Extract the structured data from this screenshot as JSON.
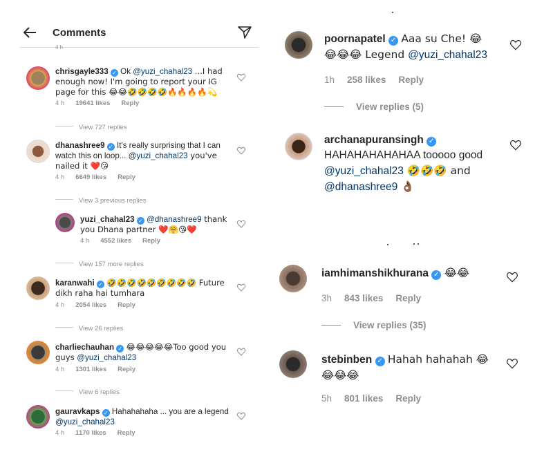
{
  "header": {
    "title": "Comments",
    "back_icon": "back-arrow-icon",
    "send_icon": "send-paper-plane-icon"
  },
  "left_comments": [
    {
      "user": "chrisgayle333",
      "text_pre": "Ok ",
      "mention": "@yuzi_chahal23",
      "text_post": " ...I had enough now! I'm going to report your IG page for this 😂😂🤣🤣🤣🤣🔥🔥🔥🔥💫",
      "time": "4 h",
      "likes": "19641 likes",
      "reply": "Reply",
      "view_replies": "View 727 replies"
    },
    {
      "user": "dhanashree9",
      "text_pre": "It's really surprising that I can watch this on loop... ",
      "mention": "@yuzi_chahal23",
      "text_post": " you've nailed it ❤️😘",
      "time": "4 h",
      "likes": "6649 likes",
      "reply": "Reply",
      "view_replies": "View 3 previous replies"
    },
    {
      "user": "yuzi_chahal23",
      "text_pre": "",
      "mention": "@dhanashree9",
      "text_post": " thank you Dhana partner ❤️🤗😘❤️",
      "time": "4 h",
      "likes": "4552 likes",
      "reply": "Reply",
      "view_replies": "View 157 more replies"
    },
    {
      "user": "karanwahi",
      "text_pre": "🤣🤣🤣🤣🤣🤣🤣🤣🤣 Future dikh raha hai tumhara",
      "mention": "",
      "text_post": "",
      "time": "4 h",
      "likes": "2054 likes",
      "reply": "Reply",
      "view_replies": "View 26 replies"
    },
    {
      "user": "charliechauhan",
      "text_pre": "😂😂😂😂😂Too good you guys ",
      "mention": "@yuzi_chahal23",
      "text_post": "",
      "time": "4 h",
      "likes": "1301 likes",
      "reply": "Reply",
      "view_replies": "View 6 replies"
    },
    {
      "user": "gauravkaps",
      "text_pre": "Hahahahaha ... you are a legend ",
      "mention": "@yuzi_chahal23",
      "text_post": "",
      "time": "4 h",
      "likes": "1170 likes",
      "reply": "Reply",
      "view_replies": ""
    }
  ],
  "right_comments": [
    {
      "user": "poornapatel",
      "line1": "Aaa su Che! 😂",
      "line2_pre": "😂😂😂 Legend ",
      "mention": "@yuzi_chahal23",
      "line3": "",
      "time": "1h",
      "likes": "258 likes",
      "reply": "Reply",
      "view_replies": "View replies (5)"
    },
    {
      "user": "archanapuransingh",
      "line1": "",
      "line2_pre": "HAHAHAHAHAHAA tooooo good ",
      "mention": "@yuzi_chahal23",
      "line3": " 🤣🤣🤣 and",
      "mention2": "@dhanashree9",
      "line4": " 👌🏾",
      "time": "",
      "likes": "",
      "reply": "",
      "view_replies": ""
    },
    {
      "user": "iamhimanshikhurana",
      "line1": "😂😂",
      "line2_pre": "",
      "mention": "",
      "line3": "",
      "time": "3h",
      "likes": "843 likes",
      "reply": "Reply",
      "view_replies": "View replies (35)"
    },
    {
      "user": "stebinben",
      "line1": "Hahah hahahah 😂",
      "line2_pre": "😂😂😂",
      "mention": "",
      "line3": "",
      "time": "5h",
      "likes": "801 likes",
      "reply": "Reply",
      "view_replies": ""
    }
  ],
  "colors": {
    "verified": "#3897f0",
    "mention": "#003569",
    "meta": "#8e8e8e"
  }
}
